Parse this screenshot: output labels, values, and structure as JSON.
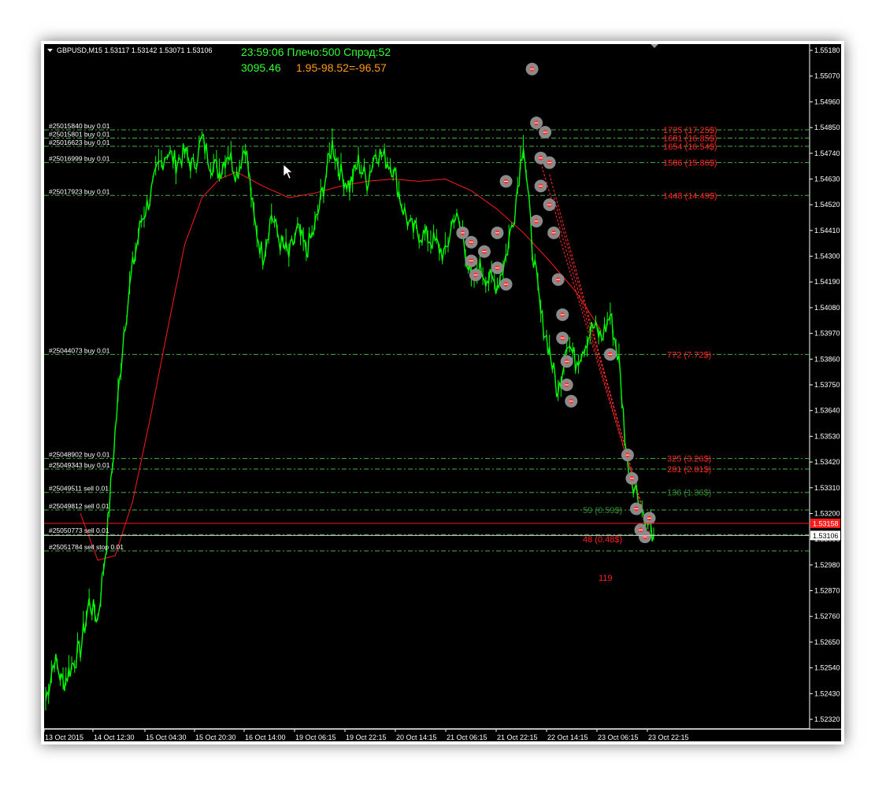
{
  "chart_data": {
    "type": "line",
    "symbol_header": "GBPUSD,M15  1.53117 1.53142 1.53071 1.53106",
    "hud_line1": "23:59:06 Плечо:500 Спрэд:52",
    "hud_balance": "3095.46",
    "hud_profit": "1.95-98.52=-96.57",
    "ylim": [
      1.5232,
      1.5518
    ],
    "y_ticks": [
      "1.55180",
      "1.55070",
      "1.54960",
      "1.54850",
      "1.54740",
      "1.54630",
      "1.54520",
      "1.54410",
      "1.54300",
      "1.54190",
      "1.54080",
      "1.53970",
      "1.53860",
      "1.53750",
      "1.53640",
      "1.53530",
      "1.53420",
      "1.53310",
      "1.53200",
      "1.53090",
      "1.52980",
      "1.52870",
      "1.52760",
      "1.52650",
      "1.52540",
      "1.52430",
      "1.52320"
    ],
    "x_ticks": [
      "13 Oct 2015",
      "14 Oct 12:30",
      "15 Oct 04:30",
      "15 Oct 20:30",
      "16 Oct 14:00",
      "19 Oct 06:15",
      "19 Oct 22:15",
      "20 Oct 14:15",
      "21 Oct 06:15",
      "21 Oct 22:15",
      "22 Oct 14:15",
      "23 Oct 06:15",
      "23 Oct 22:15"
    ],
    "current_bid": "1.53106",
    "current_ask": "1.53158",
    "price_series": [
      {
        "t": 0,
        "p": 1.524
      },
      {
        "t": 2,
        "p": 1.5258
      },
      {
        "t": 4,
        "p": 1.5247
      },
      {
        "t": 6,
        "p": 1.5255
      },
      {
        "t": 8,
        "p": 1.5262
      },
      {
        "t": 10,
        "p": 1.5282
      },
      {
        "t": 12,
        "p": 1.5275
      },
      {
        "t": 14,
        "p": 1.5308
      },
      {
        "t": 16,
        "p": 1.5355
      },
      {
        "t": 18,
        "p": 1.5398
      },
      {
        "t": 20,
        "p": 1.5425
      },
      {
        "t": 22,
        "p": 1.5445
      },
      {
        "t": 24,
        "p": 1.5455
      },
      {
        "t": 26,
        "p": 1.5468
      },
      {
        "t": 28,
        "p": 1.5475
      },
      {
        "t": 30,
        "p": 1.547
      },
      {
        "t": 32,
        "p": 1.5474
      },
      {
        "t": 34,
        "p": 1.5468
      },
      {
        "t": 36,
        "p": 1.548
      },
      {
        "t": 38,
        "p": 1.547
      },
      {
        "t": 40,
        "p": 1.5466
      },
      {
        "t": 42,
        "p": 1.5475
      },
      {
        "t": 44,
        "p": 1.5465
      },
      {
        "t": 46,
        "p": 1.5478
      },
      {
        "t": 48,
        "p": 1.5445
      },
      {
        "t": 50,
        "p": 1.543
      },
      {
        "t": 52,
        "p": 1.5448
      },
      {
        "t": 54,
        "p": 1.5436
      },
      {
        "t": 56,
        "p": 1.543
      },
      {
        "t": 58,
        "p": 1.5441
      },
      {
        "t": 60,
        "p": 1.5432
      },
      {
        "t": 62,
        "p": 1.5442
      },
      {
        "t": 64,
        "p": 1.546
      },
      {
        "t": 66,
        "p": 1.5478
      },
      {
        "t": 68,
        "p": 1.5465
      },
      {
        "t": 70,
        "p": 1.546
      },
      {
        "t": 72,
        "p": 1.547
      },
      {
        "t": 74,
        "p": 1.5462
      },
      {
        "t": 76,
        "p": 1.5475
      },
      {
        "t": 78,
        "p": 1.5472
      },
      {
        "t": 80,
        "p": 1.5468
      },
      {
        "t": 82,
        "p": 1.5452
      },
      {
        "t": 84,
        "p": 1.5442
      },
      {
        "t": 86,
        "p": 1.544
      },
      {
        "t": 88,
        "p": 1.5438
      },
      {
        "t": 90,
        "p": 1.5435
      },
      {
        "t": 92,
        "p": 1.543
      },
      {
        "t": 94,
        "p": 1.5448
      },
      {
        "t": 96,
        "p": 1.544
      },
      {
        "t": 98,
        "p": 1.5418
      },
      {
        "t": 100,
        "p": 1.5425
      },
      {
        "t": 102,
        "p": 1.542
      },
      {
        "t": 104,
        "p": 1.5418
      },
      {
        "t": 106,
        "p": 1.543
      },
      {
        "t": 108,
        "p": 1.545
      },
      {
        "t": 110,
        "p": 1.548
      },
      {
        "t": 112,
        "p": 1.5435
      },
      {
        "t": 114,
        "p": 1.5405
      },
      {
        "t": 116,
        "p": 1.539
      },
      {
        "t": 118,
        "p": 1.537
      },
      {
        "t": 120,
        "p": 1.5395
      },
      {
        "t": 122,
        "p": 1.5385
      },
      {
        "t": 124,
        "p": 1.5392
      },
      {
        "t": 126,
        "p": 1.54
      },
      {
        "t": 128,
        "p": 1.5395
      },
      {
        "t": 130,
        "p": 1.5405
      },
      {
        "t": 132,
        "p": 1.5385
      },
      {
        "t": 134,
        "p": 1.534
      },
      {
        "t": 136,
        "p": 1.533
      },
      {
        "t": 138,
        "p": 1.5318
      },
      {
        "t": 140,
        "p": 1.5311
      }
    ],
    "moving_average": [
      {
        "t": 8,
        "p": 1.532
      },
      {
        "t": 12,
        "p": 1.53
      },
      {
        "t": 16,
        "p": 1.5302
      },
      {
        "t": 20,
        "p": 1.5325
      },
      {
        "t": 24,
        "p": 1.536
      },
      {
        "t": 28,
        "p": 1.5398
      },
      {
        "t": 32,
        "p": 1.5435
      },
      {
        "t": 36,
        "p": 1.5455
      },
      {
        "t": 40,
        "p": 1.5463
      },
      {
        "t": 44,
        "p": 1.5466
      },
      {
        "t": 50,
        "p": 1.546
      },
      {
        "t": 56,
        "p": 1.5455
      },
      {
        "t": 62,
        "p": 1.5457
      },
      {
        "t": 68,
        "p": 1.546
      },
      {
        "t": 74,
        "p": 1.5462
      },
      {
        "t": 80,
        "p": 1.5463
      },
      {
        "t": 86,
        "p": 1.5462
      },
      {
        "t": 92,
        "p": 1.5463
      },
      {
        "t": 98,
        "p": 1.5458
      },
      {
        "t": 104,
        "p": 1.545
      },
      {
        "t": 110,
        "p": 1.544
      },
      {
        "t": 116,
        "p": 1.5428
      },
      {
        "t": 122,
        "p": 1.5415
      },
      {
        "t": 128,
        "p": 1.5398
      }
    ],
    "orders": [
      {
        "label": "#25015840 buy 0.01",
        "price": 1.5484,
        "pl": "1725 (17.25$)",
        "pl_color": "#ff2020"
      },
      {
        "label": "#25015801 buy 0.01",
        "price": 1.54805,
        "pl": "1681 (16.85$)",
        "pl_color": "#ff2020"
      },
      {
        "label": "#25016623 buy 0.01",
        "price": 1.5477,
        "pl": "1654 (16.54$)",
        "pl_color": "#ff2020"
      },
      {
        "label": "#25016999 buy 0.01",
        "price": 1.547,
        "pl": "1586 (15.86$)",
        "pl_color": "#ff2020"
      },
      {
        "label": "#25017923 buy 0.01",
        "price": 1.5456,
        "pl": "1448 (14.49$)",
        "pl_color": "#ff2020"
      },
      {
        "label": "#25044073 buy 0.01",
        "price": 1.5388,
        "pl": "772 (7.72$)",
        "pl_color": "#ff2020"
      },
      {
        "label": "#25048902 buy 0.01",
        "price": 1.53435,
        "pl": "325 (3.26$)",
        "pl_color": "#ff2020"
      },
      {
        "label": "#25049343 buy 0.01",
        "price": 1.5339,
        "pl": "281 (2.81$)",
        "pl_color": "#ff2020"
      },
      {
        "label": "#25049511 sell 0.01",
        "price": 1.5329,
        "pl": "136 (1.36$)",
        "pl_color": "#2e8b2e"
      },
      {
        "label": "#25049812 sell 0.01",
        "price": 1.53215,
        "pl": "59 (0.59$)",
        "pl_color": "#2e8b2e"
      },
      {
        "label": "#25050773 sell 0.01",
        "price": 1.5311,
        "pl": "48 (0.48$)",
        "pl_color": "#ff2020"
      },
      {
        "label": "#25051784 sell stop 0.01",
        "price": 1.5304,
        "pl": "119",
        "pl_color": "#ff2020"
      }
    ],
    "colors": {
      "background": "#000000",
      "price": "#00ff00",
      "moving_average": "#ff1a1a",
      "order_line": "#4fd14f",
      "ask_line": "#ff1a1a",
      "bid_line": "#d0d0d0",
      "axis": "#ffffff"
    },
    "grid": false
  }
}
